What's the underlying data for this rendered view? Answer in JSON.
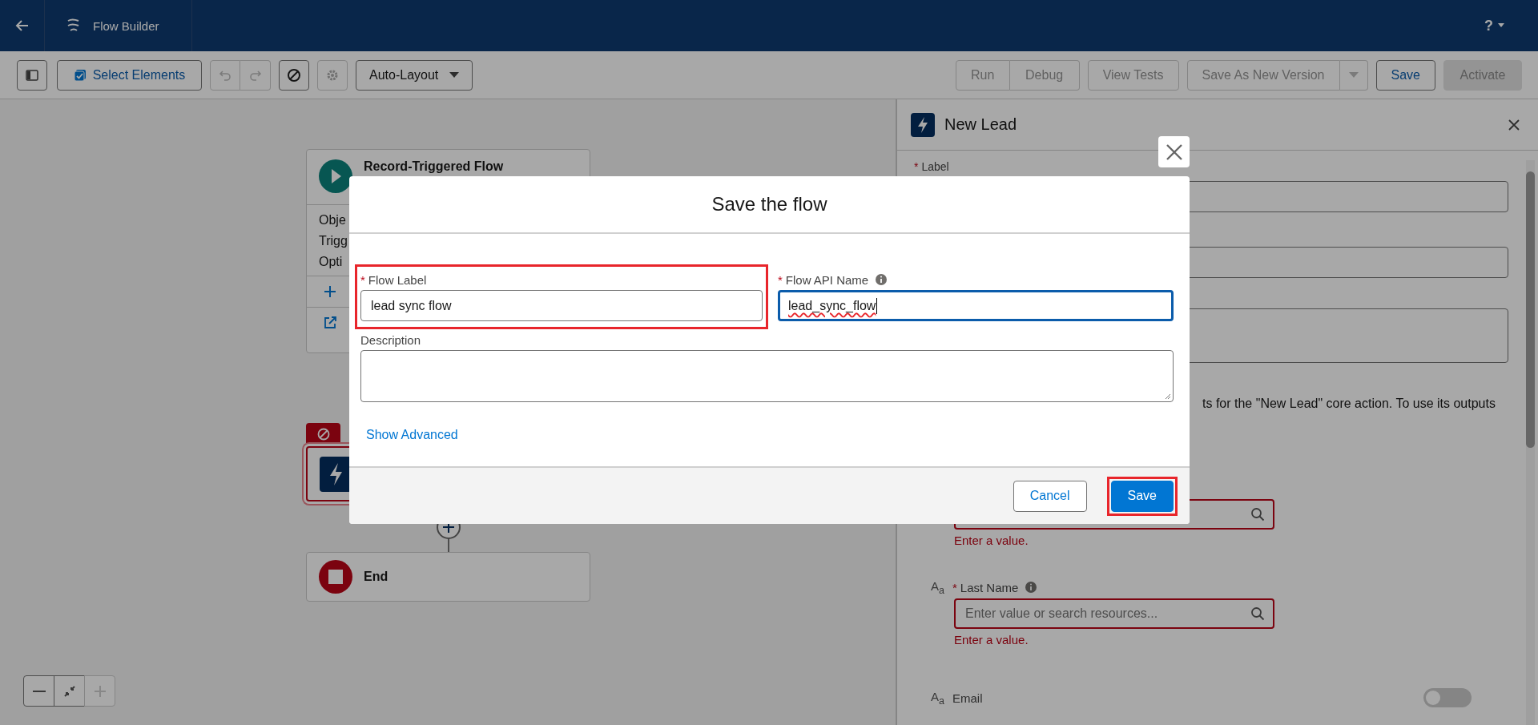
{
  "header": {
    "title": "Flow Builder",
    "help": "?"
  },
  "toolbar_left": [
    {
      "kind": "panel-toggle",
      "disabled": false
    },
    {
      "kind": "select",
      "label": "Select Elements",
      "disabled": false
    },
    {
      "kind": "undo-redo",
      "disabled": true
    },
    {
      "kind": "stop",
      "disabled": false
    },
    {
      "kind": "settings",
      "disabled": true
    },
    {
      "kind": "dropdown",
      "label": "Auto-Layout",
      "disabled": false
    }
  ],
  "toolbar_right": [
    {
      "kind": "group-start",
      "label": "Run",
      "disabled": true
    },
    {
      "kind": "group-end",
      "label": "Debug",
      "disabled": true
    },
    {
      "kind": "plain",
      "label": "View Tests",
      "disabled": true
    },
    {
      "kind": "split",
      "label": "Save As New Version",
      "disabled": true
    },
    {
      "kind": "plain",
      "label": "Save",
      "disabled": false
    },
    {
      "kind": "brand",
      "label": "Activate",
      "disabled": true
    }
  ],
  "canvas": {
    "start_node": {
      "title": "Record-Triggered Flow",
      "lines": [
        "Obje",
        "Trigg",
        "Opti"
      ]
    },
    "action_node": {
      "error": true
    },
    "end_node": {
      "title": "End"
    },
    "zoom_controls": [
      {
        "kind": "zoom-out",
        "disabled": false
      },
      {
        "kind": "fit",
        "disabled": false
      },
      {
        "kind": "zoom-in",
        "disabled": true
      }
    ]
  },
  "panel": {
    "title": "New Lead",
    "label_field": {
      "required_mark": "*",
      "label": "Label"
    },
    "note": "ts for the \"New Lead\" core action. To use its outputs",
    "resource_fields": [
      {
        "error": "Enter a value."
      },
      {
        "type_label": "A$_{a}$",
        "required_mark": "*",
        "label": "Last Name",
        "placeholder": "Enter value or search resources...",
        "error": "Enter a value.",
        "info": true
      }
    ],
    "email": {
      "type_label": "A$_{a}$",
      "label": "Email",
      "on": false
    }
  },
  "modal": {
    "title": "Save the flow",
    "fields": [
      {
        "kind": "input",
        "required_mark": "*",
        "label": "Flow Label",
        "value": "lead sync flow",
        "focused": false,
        "highlighted": true
      },
      {
        "kind": "input",
        "required_mark": "*",
        "label": "Flow API Name",
        "value": "lead_sync_flow",
        "focused": true,
        "highlighted": false,
        "info": true,
        "spellcheck_flag": true
      },
      {
        "kind": "textarea",
        "label": "Description",
        "focused": false,
        "highlighted": false
      }
    ],
    "link": "Show Advanced",
    "buttons": [
      {
        "kind": "neutral",
        "label": "Cancel",
        "highlighted": false
      },
      {
        "kind": "brand",
        "label": "Save",
        "highlighted": true
      }
    ]
  }
}
